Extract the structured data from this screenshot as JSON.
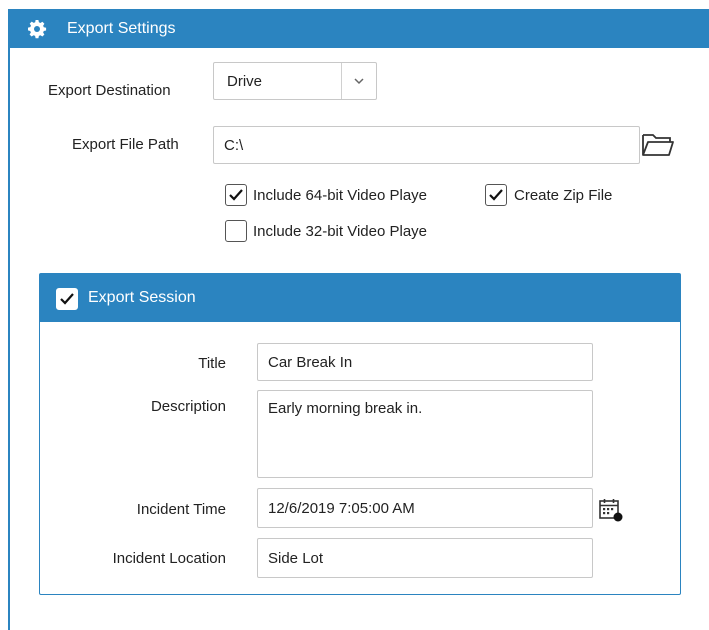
{
  "header": {
    "title": "Export Settings"
  },
  "export_destination": {
    "label": "Export Destination",
    "value": "Drive"
  },
  "export_file_path": {
    "label": "Export File Path",
    "value": "C:\\"
  },
  "checkboxes": [
    {
      "label": "Include 64-bit Video Playe",
      "checked": true
    },
    {
      "label": "Create Zip File",
      "checked": true
    },
    {
      "label": "Include 32-bit Video Playe",
      "checked": false
    }
  ],
  "session": {
    "title_label": "Export Session",
    "checked": true,
    "fields": {
      "title": {
        "label": "Title",
        "value": "Car Break In"
      },
      "description": {
        "label": "Description",
        "value": "Early morning break in."
      },
      "incident_time": {
        "label": "Incident Time",
        "value": "12/6/2019 7:05:00 AM"
      },
      "incident_location": {
        "label": "Incident Location",
        "value": "Side Lot"
      }
    }
  },
  "colors": {
    "accent": "#2b84c0"
  },
  "icons": [
    "gear-icon",
    "chevron-down-icon",
    "folder-icon",
    "checkmark-icon",
    "calendar-icon"
  ]
}
